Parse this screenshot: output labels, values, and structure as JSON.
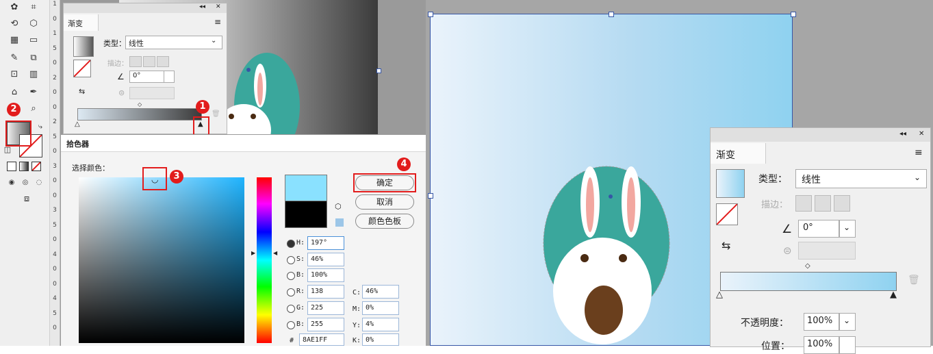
{
  "left_gradient_panel": {
    "title": "渐变",
    "collapse_glyph": "◂◂",
    "close_glyph": "✕",
    "menu_glyph": "≡",
    "type_label": "类型：",
    "type_value": "线性",
    "stroke_label": "描边：",
    "angle_value": "0°"
  },
  "ruler_numbers": [
    "1",
    "0",
    "1",
    "5",
    "0",
    "2",
    "0",
    "0",
    "2",
    "5",
    "0",
    "3",
    "0",
    "0",
    "3",
    "5",
    "0",
    "4",
    "0",
    "0",
    "4",
    "5",
    "0"
  ],
  "color_picker": {
    "title": "拾色器",
    "select_color_label": "选择颜色：",
    "ok_button": "确定",
    "cancel_button": "取消",
    "swatches_button": "颜色色板",
    "h_label": "H:",
    "h_value": "197°",
    "s_label": "S:",
    "s_value": "46%",
    "b_label": "B:",
    "b_value": "100%",
    "r_label": "R:",
    "r_value": "138",
    "g_label": "G:",
    "g_value": "225",
    "b2_label": "B:",
    "b2_value": "255",
    "hex_label": "#",
    "hex_value": "8AE1FF",
    "c_label": "C:",
    "c_value": "46%",
    "m_label": "M:",
    "m_value": "0%",
    "y_label": "Y:",
    "y_value": "4%",
    "k_label": "K:",
    "k_value": "0%"
  },
  "markers": [
    "1",
    "2",
    "3",
    "4"
  ],
  "right_gradient_panel": {
    "title": "渐变",
    "collapse_glyph": "◂◂",
    "close_glyph": "✕",
    "menu_glyph": "≡",
    "type_label": "类型：",
    "type_value": "线性",
    "stroke_label": "描边：",
    "angle_value": "0°",
    "opacity_label": "不透明度：",
    "opacity_value": "100%",
    "position_label": "位置：",
    "position_value": "100%"
  },
  "colors": {
    "accent_red": "#e21c1c",
    "gradient_start": "#eaf3fb",
    "gradient_end": "#8fd2f0",
    "picked_color": "#8AE1FF",
    "selection_blue": "#3656a6"
  }
}
